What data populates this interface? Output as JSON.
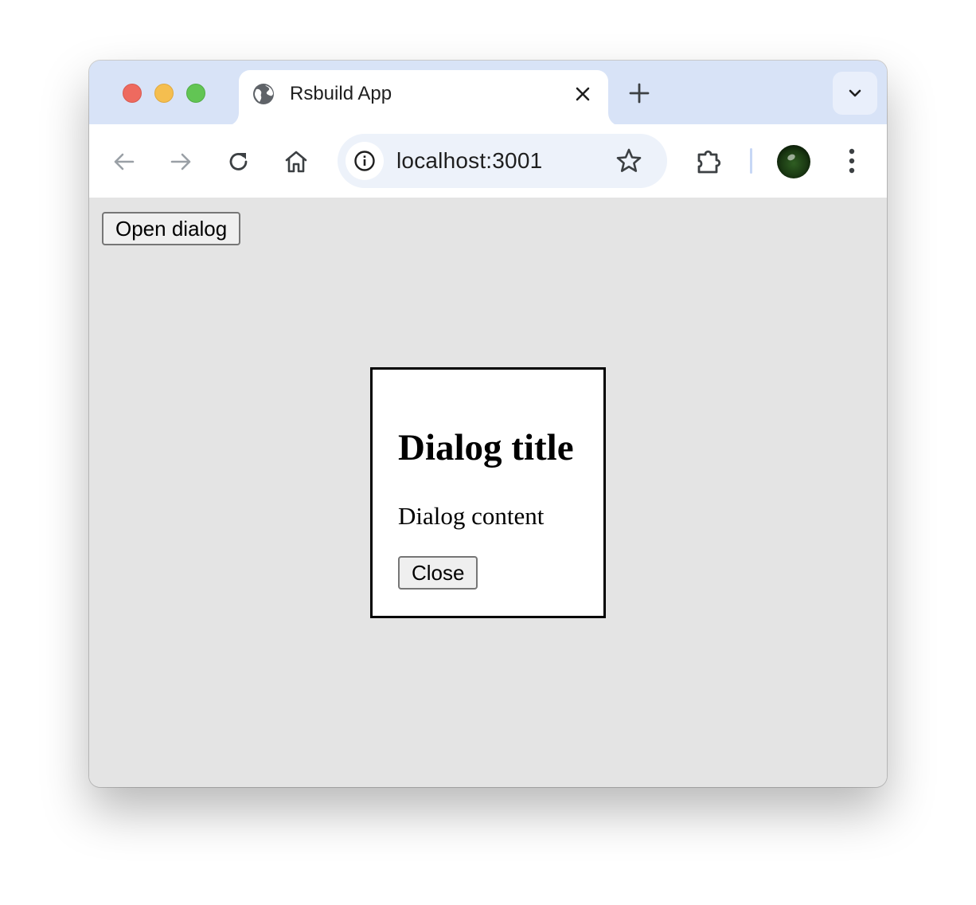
{
  "browser": {
    "tab": {
      "title": "Rsbuild App",
      "favicon": "globe-icon"
    },
    "new_tab_icon": "plus-icon",
    "tab_search_icon": "chevron-down-icon",
    "toolbar": {
      "back_icon": "arrow-left-icon",
      "forward_icon": "arrow-right-icon",
      "reload_icon": "reload-icon",
      "home_icon": "home-icon",
      "site_info_icon": "info-icon",
      "url": "localhost:3001",
      "bookmark_icon": "star-icon",
      "extensions_icon": "puzzle-icon",
      "profile": "avatar",
      "menu_icon": "more-vertical-icon"
    },
    "colors": {
      "tabstrip": "#d8e3f7",
      "omnibox": "#edf2fa",
      "close": "#ee6a5f",
      "minimize": "#f5be4f",
      "zoom": "#62c554"
    }
  },
  "page": {
    "open_button_label": "Open dialog",
    "background": "#e4e4e4",
    "dialog": {
      "title": "Dialog title",
      "content": "Dialog content",
      "close_label": "Close"
    }
  }
}
